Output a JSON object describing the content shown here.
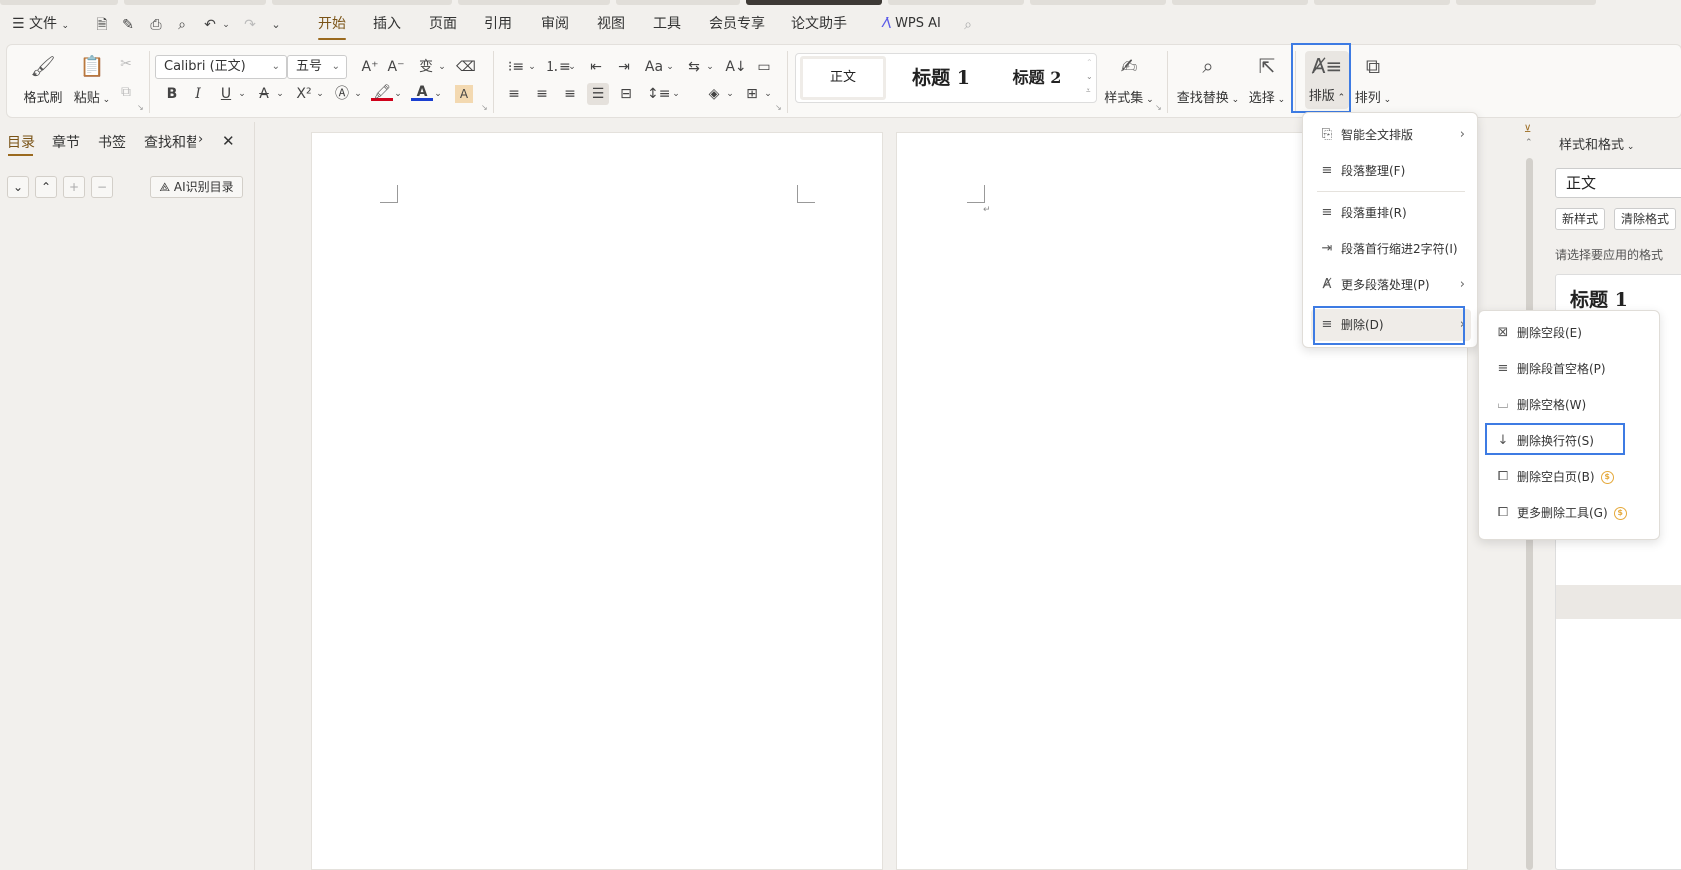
{
  "menubar": {
    "file": "文件",
    "tabs": [
      "开始",
      "插入",
      "页面",
      "引用",
      "审阅",
      "视图",
      "工具",
      "会员专享",
      "论文助手"
    ],
    "active_tab": "开始",
    "wps_ai": "WPS AI"
  },
  "ribbon": {
    "format_painter": "格式刷",
    "paste": "粘贴",
    "font_name": "Calibri (正文)",
    "font_size": "五号",
    "style_normal": "正文",
    "style_h1": "标题 1",
    "style_h2": "标题 2",
    "style_set": "样式集",
    "find_replace": "查找替换",
    "select": "选择",
    "typeset": "排版",
    "arrange": "排列"
  },
  "navpane": {
    "tabs": [
      "目录",
      "章节",
      "书签",
      "查找和替"
    ],
    "active_tab": "目录",
    "ai_toc": "AI识别目录"
  },
  "rightpanel": {
    "title": "样式和格式",
    "current_style": "正文",
    "new_style": "新样式",
    "clear_format": "清除格式",
    "hint": "请选择要应用的格式",
    "list_first": "标题 1"
  },
  "typeset_menu": {
    "items": [
      {
        "label": "智能全文排版",
        "submenu": true
      },
      {
        "label": "段落整理(F)",
        "submenu": false
      },
      {
        "label": "段落重排(R)",
        "submenu": false
      },
      {
        "label": "段落首行缩进2字符(I)",
        "submenu": false
      },
      {
        "label": "更多段落处理(P)",
        "submenu": true
      },
      {
        "label": "删除(D)",
        "submenu": true
      }
    ]
  },
  "delete_menu": {
    "items": [
      {
        "label": "删除空段(E)",
        "premium": false
      },
      {
        "label": "删除段首空格(P)",
        "premium": false
      },
      {
        "label": "删除空格(W)",
        "premium": false
      },
      {
        "label": "删除换行符(S)",
        "premium": false
      },
      {
        "label": "删除空白页(B)",
        "premium": true
      },
      {
        "label": "更多删除工具(G)",
        "premium": true
      }
    ]
  },
  "colors": {
    "accent_brown": "#7a5316",
    "highlight_blue": "#3d7be3",
    "premium_gold": "#e5a93b",
    "font_color_red": "#d0021b",
    "font_color_blue": "#1a3fd1"
  },
  "icons": {
    "para_mark": "↵",
    "coin": "$"
  }
}
